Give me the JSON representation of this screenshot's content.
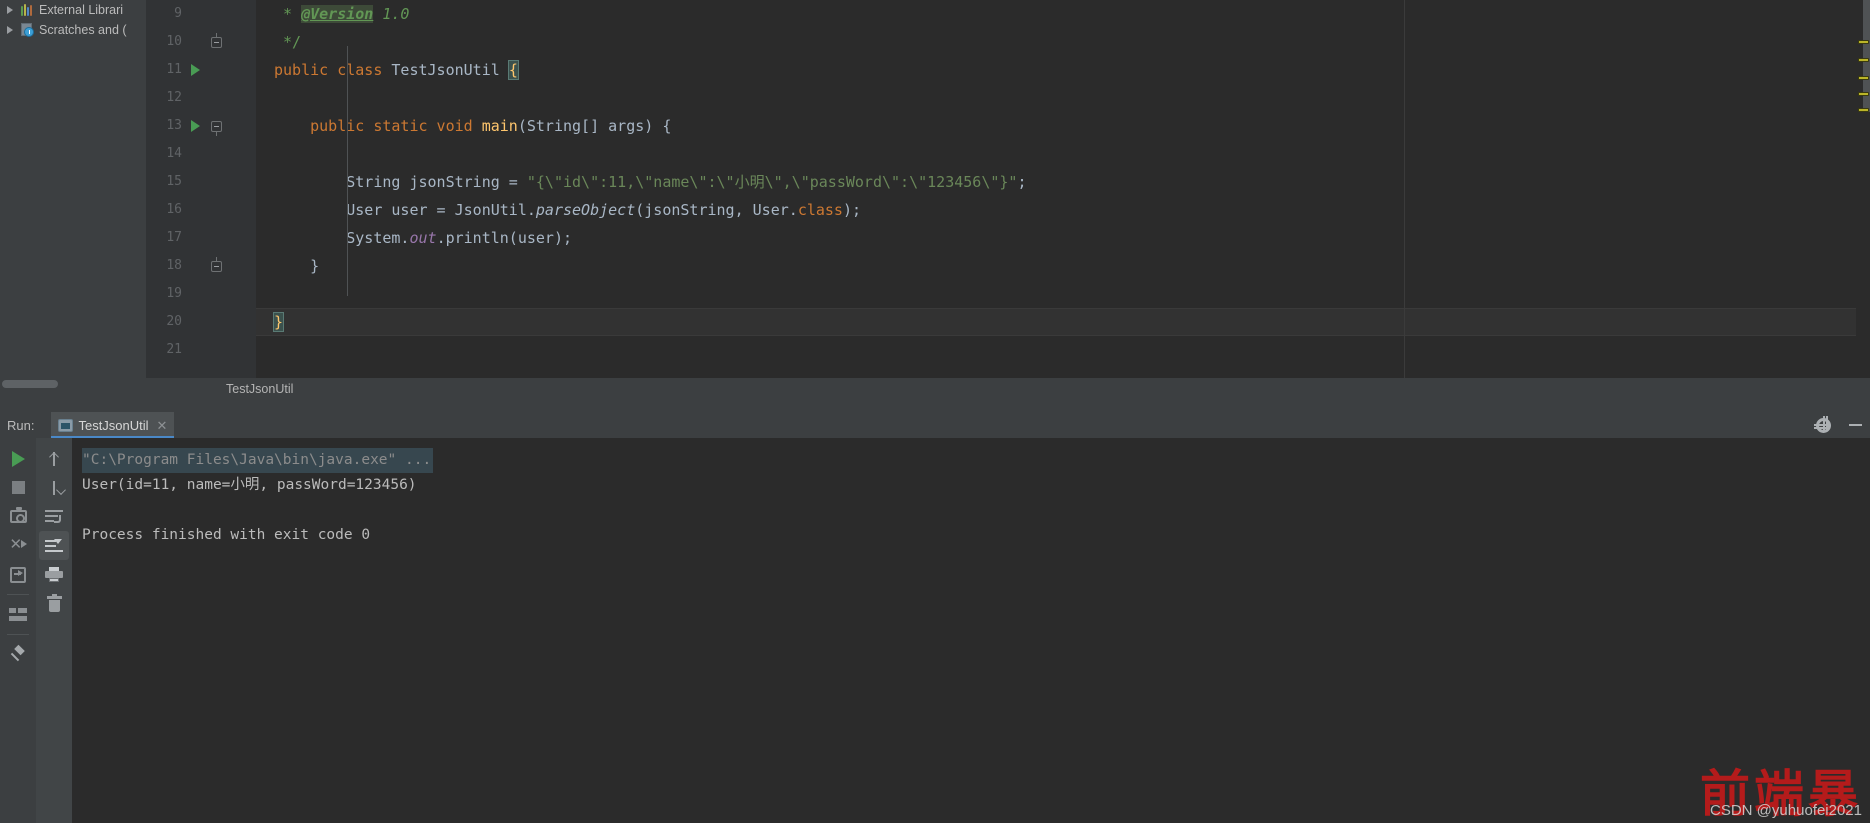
{
  "sidebar": {
    "items": [
      {
        "label": "External Librari",
        "icon": "library-bars-icon"
      },
      {
        "label": "Scratches and (",
        "icon": "scratches-clock-icon"
      }
    ]
  },
  "editor": {
    "breadcrumb": "TestJsonUtil",
    "background": "#2b2b2b",
    "gutter_background": "#313335",
    "lines": [
      {
        "num": "9",
        "runmark": false,
        "fold": "",
        "segments": [
          {
            "text": " * ",
            "cls": "cmt"
          },
          {
            "text": "@Version",
            "cls": "doctag"
          },
          {
            "text": " 1.0",
            "cls": "docval"
          }
        ]
      },
      {
        "num": "10",
        "runmark": false,
        "fold": "up",
        "segments": [
          {
            "text": " */",
            "cls": "cmt"
          }
        ]
      },
      {
        "num": "11",
        "runmark": true,
        "fold": "",
        "segments": [
          {
            "text": "public class ",
            "cls": "kw"
          },
          {
            "text": "TestJsonUtil ",
            "cls": ""
          },
          {
            "text": "{",
            "cls": "bracehl"
          }
        ]
      },
      {
        "num": "12",
        "runmark": false,
        "fold": "",
        "segments": []
      },
      {
        "num": "13",
        "runmark": true,
        "fold": "down",
        "segments": [
          {
            "text": "    ",
            "cls": ""
          },
          {
            "text": "public static void ",
            "cls": "kw"
          },
          {
            "text": "main",
            "cls": "fn"
          },
          {
            "text": "(String[] args) {",
            "cls": ""
          }
        ]
      },
      {
        "num": "14",
        "runmark": false,
        "fold": "",
        "segments": []
      },
      {
        "num": "15",
        "runmark": false,
        "fold": "",
        "segments": [
          {
            "text": "        String jsonString = ",
            "cls": ""
          },
          {
            "text": "\"{\\\"id\\\":11,\\\"name\\\":\\\"小明\\\",\\\"passWord\\\":\\\"123456\\\"}\"",
            "cls": "str"
          },
          {
            "text": ";",
            "cls": ""
          }
        ]
      },
      {
        "num": "16",
        "runmark": false,
        "fold": "",
        "segments": [
          {
            "text": "        User user = JsonUtil.",
            "cls": ""
          },
          {
            "text": "parseObject",
            "cls": "ital"
          },
          {
            "text": "(jsonString, User.",
            "cls": ""
          },
          {
            "text": "class",
            "cls": "kw"
          },
          {
            "text": ");",
            "cls": ""
          }
        ]
      },
      {
        "num": "17",
        "runmark": false,
        "fold": "",
        "segments": [
          {
            "text": "        System.",
            "cls": ""
          },
          {
            "text": "out",
            "cls": "field"
          },
          {
            "text": ".println(user);",
            "cls": ""
          }
        ]
      },
      {
        "num": "18",
        "runmark": false,
        "fold": "up",
        "segments": [
          {
            "text": "    }",
            "cls": ""
          }
        ]
      },
      {
        "num": "19",
        "runmark": false,
        "fold": "",
        "segments": []
      },
      {
        "num": "20",
        "runmark": false,
        "fold": "",
        "segments": [
          {
            "text": "}",
            "cls": "bracehl"
          }
        ]
      },
      {
        "num": "21",
        "runmark": false,
        "fold": "",
        "segments": []
      }
    ],
    "markers": {
      "color": "#bbb529",
      "count": 5
    }
  },
  "run_panel": {
    "label": "Run:",
    "tab": {
      "title": "TestJsonUtil",
      "close": "✕",
      "accent": "#4a88c7"
    },
    "header_actions": [
      {
        "name": "settings-gear",
        "icon": "gear-icon"
      },
      {
        "name": "hide-panel",
        "icon": "minimize-icon"
      }
    ],
    "toolbar_left": [
      {
        "name": "rerun-button",
        "icon": "play-icon",
        "selected": false
      },
      {
        "name": "stop-button",
        "icon": "stop-icon",
        "selected": false
      },
      {
        "name": "screenshot-button",
        "icon": "camera-icon",
        "selected": false
      },
      {
        "name": "rerun-failed-button",
        "icon": "rerun-failed-icon",
        "selected": false
      },
      {
        "name": "export-button",
        "icon": "export-icon",
        "selected": false
      },
      {
        "name": "layout-button",
        "icon": "layout-icon",
        "selected": false
      },
      {
        "name": "pin-tab-button",
        "icon": "pin-icon",
        "selected": false
      }
    ],
    "toolbar_right": [
      {
        "name": "up-button",
        "icon": "arrow-up-icon",
        "selected": false
      },
      {
        "name": "down-button",
        "icon": "arrow-down-icon",
        "selected": false
      },
      {
        "name": "soft-wrap-button",
        "icon": "soft-wrap-icon",
        "selected": false
      },
      {
        "name": "scroll-to-end-button",
        "icon": "scroll-end-icon",
        "selected": true
      },
      {
        "name": "print-button",
        "icon": "print-icon",
        "selected": false
      },
      {
        "name": "clear-all-button",
        "icon": "trash-icon",
        "selected": false
      }
    ],
    "console": {
      "command": "\"C:\\Program Files\\Java\\bin\\java.exe\" ...",
      "output": "User(id=11, name=小明, passWord=123456)",
      "blank": "",
      "status": "Process finished with exit code 0"
    }
  },
  "watermark": {
    "cn": "前端暴",
    "en": "CSDN @yuhuofei2021",
    "color": "#c01a1a"
  }
}
